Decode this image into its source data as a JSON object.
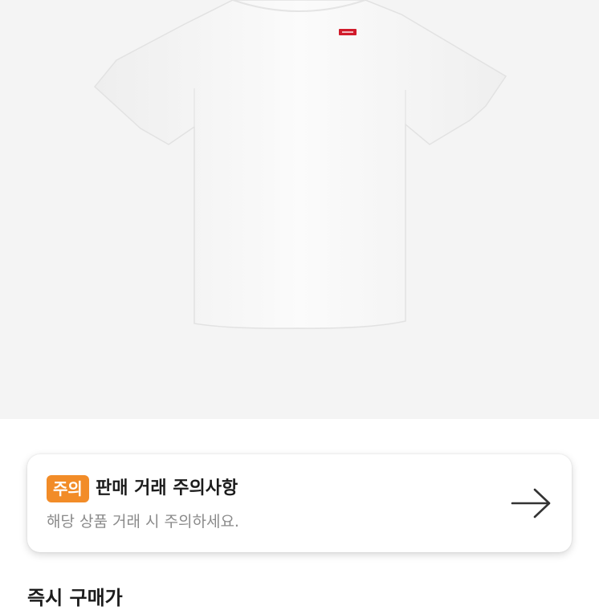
{
  "product": {
    "image_subject": "white t-shirt",
    "logo_color": "#d11b2b",
    "background_color": "#f4f4f4"
  },
  "notice": {
    "badge": "주의",
    "title": "판매 거래 주의사항",
    "subtitle": "해당 상품 거래 시 주의하세요.",
    "arrow_icon": "arrow-right-icon",
    "badge_color": "#f28c28"
  },
  "section": {
    "title": "즉시 구매가"
  }
}
